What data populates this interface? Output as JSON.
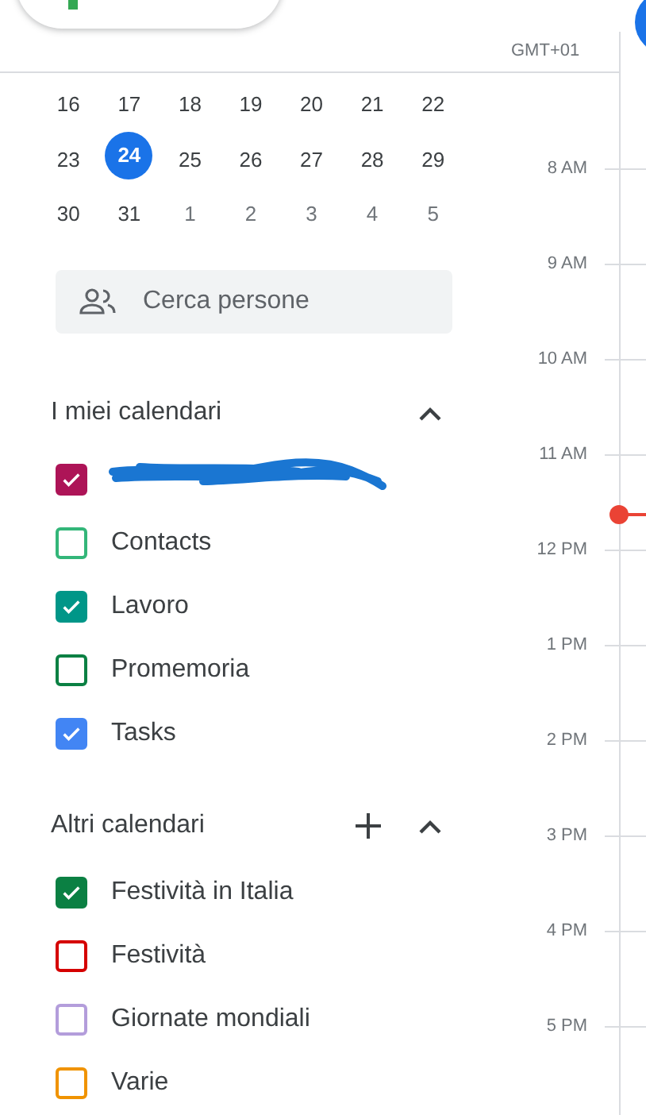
{
  "timezone": "GMT+01",
  "mini_calendar": {
    "weeks": [
      [
        {
          "day": "16",
          "selected": false,
          "muted": false
        },
        {
          "day": "17",
          "selected": false,
          "muted": false
        },
        {
          "day": "18",
          "selected": false,
          "muted": false
        },
        {
          "day": "19",
          "selected": false,
          "muted": false
        },
        {
          "day": "20",
          "selected": false,
          "muted": false
        },
        {
          "day": "21",
          "selected": false,
          "muted": false
        },
        {
          "day": "22",
          "selected": false,
          "muted": false
        }
      ],
      [
        {
          "day": "23",
          "selected": false,
          "muted": false
        },
        {
          "day": "24",
          "selected": true,
          "muted": false
        },
        {
          "day": "25",
          "selected": false,
          "muted": false
        },
        {
          "day": "26",
          "selected": false,
          "muted": false
        },
        {
          "day": "27",
          "selected": false,
          "muted": false
        },
        {
          "day": "28",
          "selected": false,
          "muted": false
        },
        {
          "day": "29",
          "selected": false,
          "muted": false
        }
      ],
      [
        {
          "day": "30",
          "selected": false,
          "muted": false
        },
        {
          "day": "31",
          "selected": false,
          "muted": false
        },
        {
          "day": "1",
          "selected": false,
          "muted": true
        },
        {
          "day": "2",
          "selected": false,
          "muted": true
        },
        {
          "day": "3",
          "selected": false,
          "muted": true
        },
        {
          "day": "4",
          "selected": false,
          "muted": true
        },
        {
          "day": "5",
          "selected": false,
          "muted": true
        }
      ]
    ]
  },
  "people_search": {
    "placeholder": "Cerca persone"
  },
  "calendar_groups": [
    {
      "title": "I miei calendari",
      "expanded": true,
      "can_add": false,
      "items": [
        {
          "kind": "redacted",
          "color": "#ad1457",
          "checked": true
        },
        {
          "kind": "text",
          "label": "Contacts",
          "color": "#33b679",
          "checked": false
        },
        {
          "kind": "text",
          "label": "Lavoro",
          "color": "#009688",
          "checked": true
        },
        {
          "kind": "text",
          "label": "Promemoria",
          "color": "#0b8043",
          "checked": false
        },
        {
          "kind": "text",
          "label": "Tasks",
          "color": "#4285f4",
          "checked": true
        }
      ]
    },
    {
      "title": "Altri calendari",
      "expanded": true,
      "can_add": true,
      "items": [
        {
          "kind": "text",
          "label": "Festività in Italia",
          "color": "#0b8043",
          "checked": true
        },
        {
          "kind": "text",
          "label": "Festività",
          "color": "#d50000",
          "checked": false
        },
        {
          "kind": "text",
          "label": "Giornate mondiali",
          "color": "#b39ddb",
          "checked": false
        },
        {
          "kind": "text",
          "label": "Varie",
          "color": "#f09300",
          "checked": false
        }
      ]
    }
  ],
  "time_labels": [
    "8 AM",
    "9 AM",
    "10 AM",
    "11 AM",
    "12 PM",
    "1 PM",
    "2 PM",
    "3 PM",
    "4 PM",
    "5 PM"
  ]
}
